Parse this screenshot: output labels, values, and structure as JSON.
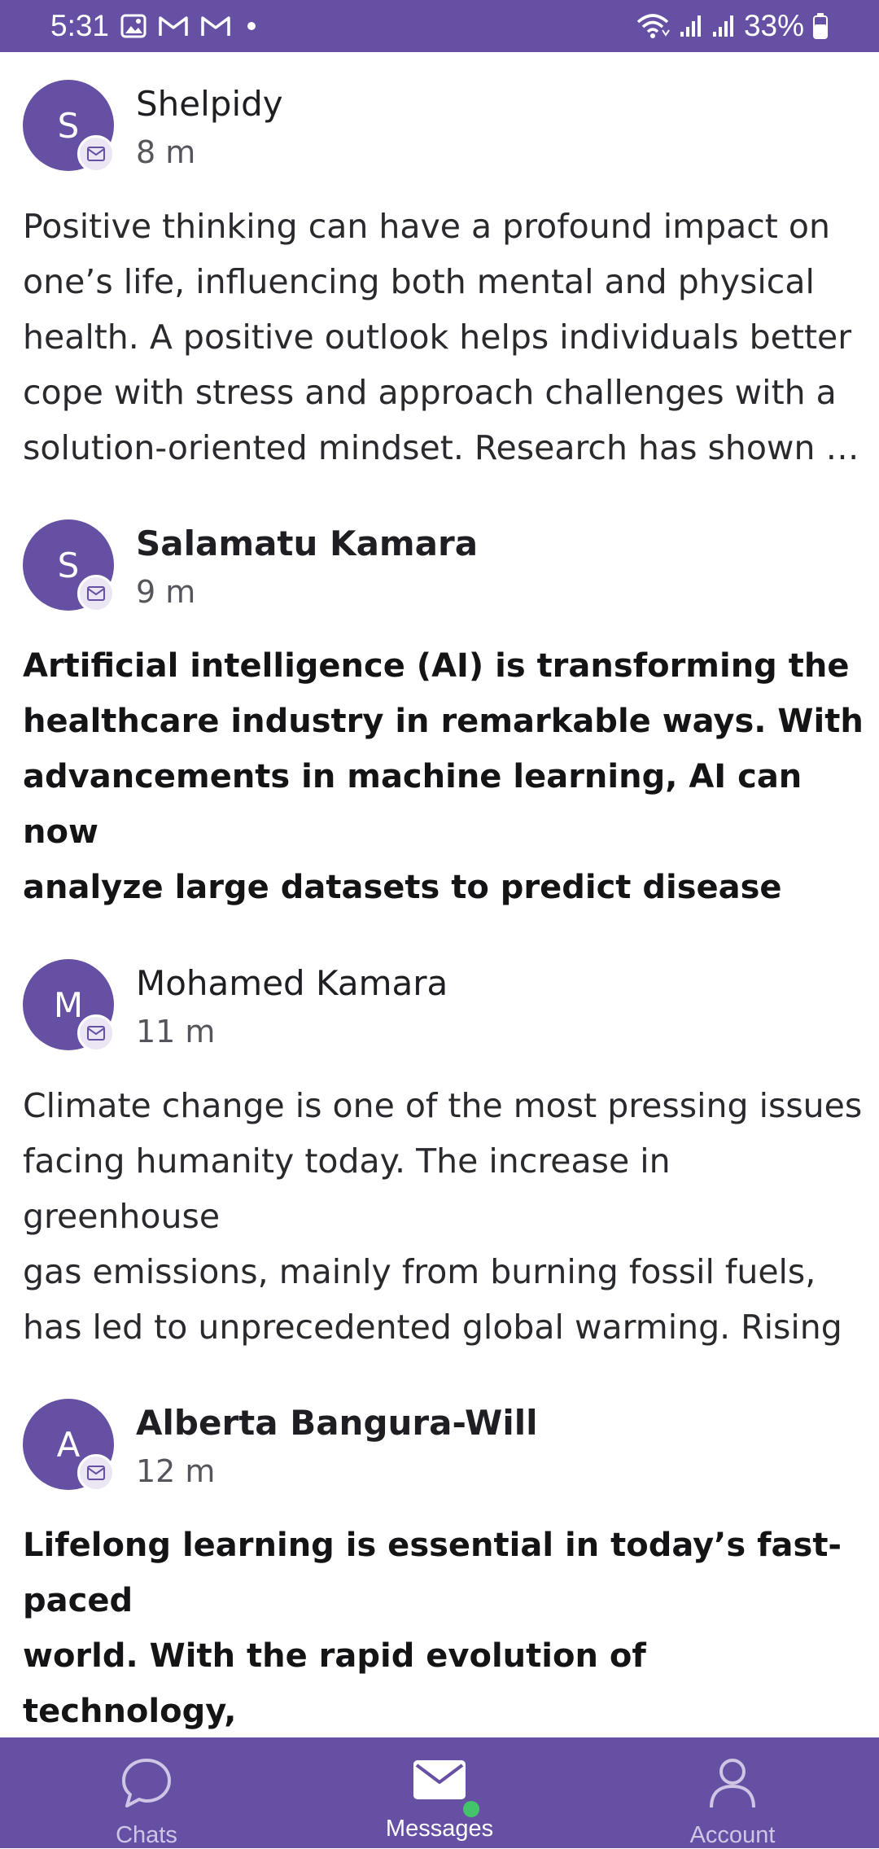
{
  "status_bar": {
    "time": "5:31",
    "battery": "33%",
    "icons": [
      "image-icon",
      "gmail-icon",
      "gmail-icon",
      "dot-icon",
      "wifi-icon",
      "signal-icon",
      "signal-icon",
      "battery-icon"
    ]
  },
  "messages": [
    {
      "initial": "S",
      "sender": "Shelpidy",
      "time": "8 m",
      "unread": false,
      "preview": "Positive thinking can have a profound impact on\none’s life, influencing both mental and physical\nhealth. A positive outlook helps individuals better\ncope with stress and approach challenges with a\nsolution-oriented mindset. Research has shown …"
    },
    {
      "initial": "S",
      "sender": "Salamatu Kamara",
      "time": "9 m",
      "unread": true,
      "preview": "Artificial intelligence (AI) is transforming the\nhealthcare industry in remarkable ways. With\nadvancements in machine learning, AI can now\nanalyze large datasets to predict disease outcomes,\nassist in diagnoses, and personalize treatment pla…"
    },
    {
      "initial": "M",
      "sender": "Mohamed Kamara",
      "time": "11 m",
      "unread": false,
      "preview": "Climate change is one of the most pressing issues\nfacing humanity today. The increase in greenhouse\ngas emissions, mainly from burning fossil fuels,\nhas led to unprecedented global warming. Rising\ntemperatures affect weather patterns, causing m…"
    },
    {
      "initial": "A",
      "sender": "Alberta Bangura-Will",
      "time": "12 m",
      "unread": true,
      "preview": "Lifelong learning is essential in today’s fast-paced\nworld. With the rapid evolution of technology,\nskills that were relevant a decade ago can quickly\nbecome obsolete. Staying updated and adaptable is"
    }
  ],
  "bottom_nav": {
    "chats": "Chats",
    "messages": "Messages",
    "account": "Account",
    "active": "messages"
  },
  "colors": {
    "brand": "#6650a4",
    "badge": "#ece6f4",
    "online": "#43c46a"
  }
}
